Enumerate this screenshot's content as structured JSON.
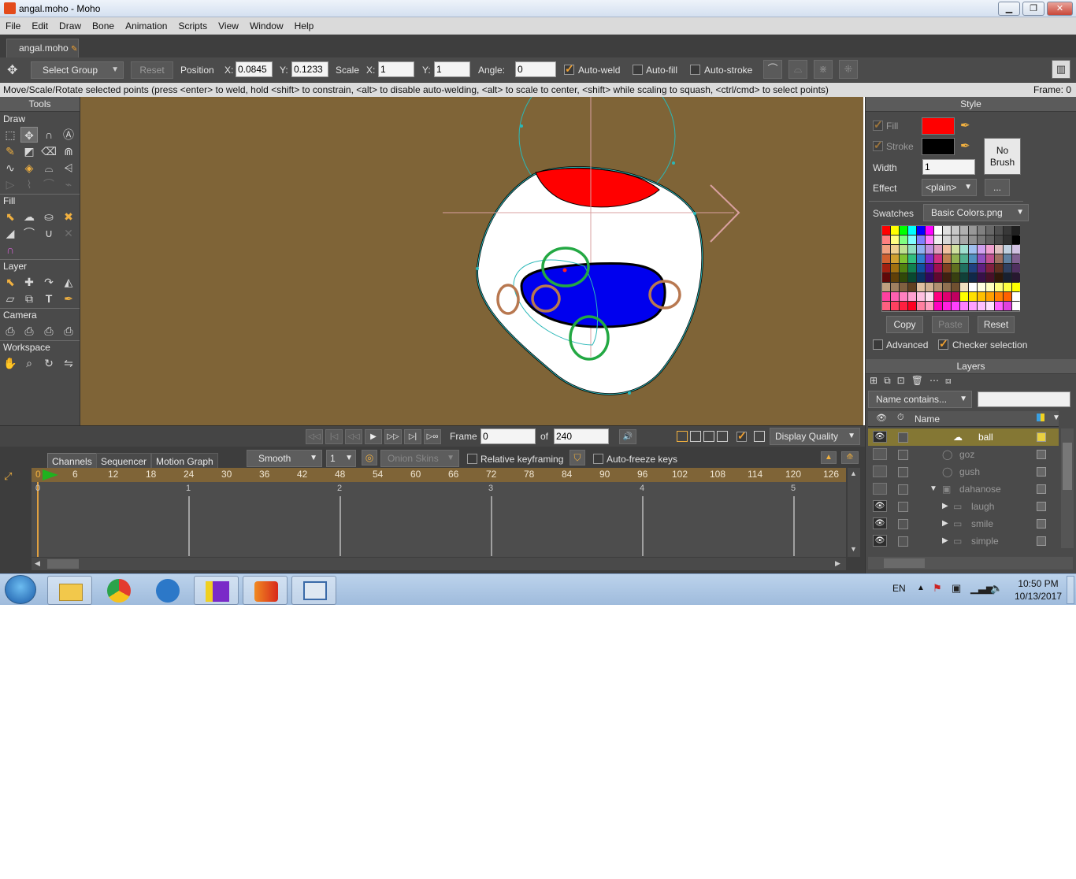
{
  "window": {
    "title": "angal.moho - Moho",
    "btn_minimize": "▁",
    "btn_maximize": "❐",
    "btn_close": "✕"
  },
  "menu": [
    "File",
    "Edit",
    "Draw",
    "Bone",
    "Animation",
    "Scripts",
    "View",
    "Window",
    "Help"
  ],
  "doc_tab": "angal.moho",
  "toolbar": {
    "mode": "Select Group",
    "reset": "Reset",
    "position_label": "Position",
    "x_label": "X:",
    "x_value": "0.0845",
    "y_label": "Y:",
    "y_value": "0.1233",
    "scale_label": "Scale",
    "sx_label": "X:",
    "sx_value": "1",
    "sy_label": "Y:",
    "sy_value": "1",
    "angle_label": "Angle:",
    "angle_value": "0",
    "auto_weld": "Auto-weld",
    "auto_weld_checked": true,
    "auto_fill": "Auto-fill",
    "auto_fill_checked": false,
    "auto_stroke": "Auto-stroke",
    "auto_stroke_checked": false
  },
  "status": {
    "message": "Move/Scale/Rotate selected points (press <enter> to weld, hold <shift> to constrain, <alt> to disable auto-welding, <alt> to scale to center, <shift> while scaling to squash, <ctrl/cmd> to select points)",
    "frame": "Frame: 0"
  },
  "tools": {
    "title": "Tools",
    "sections": [
      "Draw",
      "Fill",
      "Layer",
      "Camera",
      "Workspace"
    ]
  },
  "style": {
    "title": "Style",
    "fill_label": "Fill",
    "fill_color": "#ff0000",
    "stroke_label": "Stroke",
    "stroke_color": "#000000",
    "no_brush": "No Brush",
    "width_label": "Width",
    "width_value": "1",
    "effect_label": "Effect",
    "effect_value": "<plain>",
    "effect_more": "...",
    "swatches_label": "Swatches",
    "swatches_value": "Basic Colors.png",
    "copy": "Copy",
    "paste": "Paste",
    "reset": "Reset",
    "advanced": "Advanced",
    "advanced_checked": false,
    "checker": "Checker selection",
    "checker_checked": true
  },
  "layers": {
    "title": "Layers",
    "filter": "Name contains...",
    "name_header": "Name",
    "items": [
      {
        "name": "ball",
        "visible": true,
        "selected": true
      },
      {
        "name": "goz",
        "visible": false
      },
      {
        "name": "gush",
        "visible": false
      },
      {
        "name": "dahanose",
        "visible": false,
        "group": true,
        "expanded": true
      },
      {
        "name": "laugh",
        "visible": true,
        "group": true
      },
      {
        "name": "smile",
        "visible": true,
        "group": true
      },
      {
        "name": "simple",
        "visible": true,
        "group": true
      }
    ]
  },
  "playback": {
    "frame_label": "Frame",
    "frame_value": "0",
    "of_label": "of",
    "total_value": "240",
    "display_quality": "Display Quality"
  },
  "timeline": {
    "tabs": [
      "Channels",
      "Sequencer",
      "Motion Graph"
    ],
    "interp": "Smooth",
    "interp_count": "1",
    "onion_skins": "Onion Skins",
    "relative_kf": "Relative keyframing",
    "auto_freeze": "Auto-freeze keys",
    "ruler": [
      "0",
      "6",
      "12",
      "18",
      "24",
      "30",
      "36",
      "42",
      "48",
      "54",
      "60",
      "66",
      "72",
      "78",
      "84",
      "90",
      "96",
      "102",
      "108",
      "114",
      "120",
      "126"
    ],
    "seconds": [
      "0",
      "1",
      "2",
      "3",
      "4",
      "5"
    ]
  },
  "taskbar": {
    "lang": "EN",
    "time": "10:50 PM",
    "date": "10/13/2017"
  }
}
